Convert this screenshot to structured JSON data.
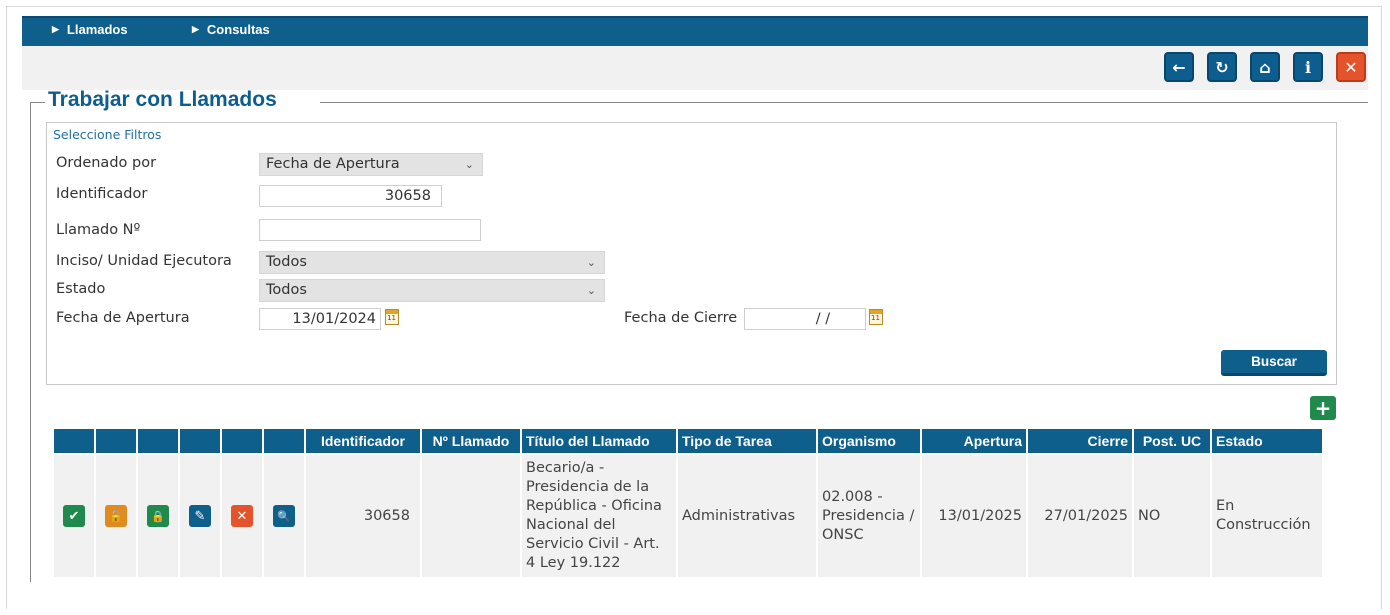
{
  "nav": {
    "items": [
      {
        "label": "Llamados"
      },
      {
        "label": "Consultas"
      }
    ]
  },
  "toolbar": {
    "buttons": [
      {
        "name": "back-icon",
        "glyph": "←"
      },
      {
        "name": "refresh-icon",
        "glyph": "↻"
      },
      {
        "name": "home-icon",
        "glyph": "⌂"
      },
      {
        "name": "info-icon",
        "glyph": "i"
      },
      {
        "name": "close-icon",
        "glyph": "✕"
      }
    ]
  },
  "page": {
    "title": "Trabajar con Llamados"
  },
  "filters": {
    "legend": "Seleccione Filtros",
    "ordenado_por": {
      "label": "Ordenado por",
      "value": "Fecha de Apertura"
    },
    "identificador": {
      "label": "Identificador",
      "value": "30658"
    },
    "llamado_no": {
      "label": "Llamado Nº",
      "value": ""
    },
    "inciso": {
      "label": "Inciso/ Unidad Ejecutora",
      "value": "Todos"
    },
    "estado": {
      "label": "Estado",
      "value": "Todos"
    },
    "fecha_apertura": {
      "label": "Fecha de Apertura",
      "value": "13/01/2024"
    },
    "fecha_cierre": {
      "label": "Fecha de Cierre",
      "value": "/ /"
    },
    "search_label": "Buscar",
    "calendar_day": "11"
  },
  "add_button": {
    "glyph": "+"
  },
  "grid": {
    "columns": [
      "",
      "",
      "",
      "",
      "",
      "",
      "Identificador",
      "Nº Llamado",
      "Título del Llamado",
      "Tipo de Tarea",
      "Organismo",
      "Apertura",
      "Cierre",
      "Post. UC",
      "Estado"
    ],
    "actions": [
      {
        "name": "approve-icon",
        "glyph": "✔",
        "color": "#1f8a4c"
      },
      {
        "name": "lock-open-icon",
        "glyph": "🔓",
        "color": "#e08a1f"
      },
      {
        "name": "lock-icon",
        "glyph": "🔒",
        "color": "#1f8a4c"
      },
      {
        "name": "edit-icon",
        "glyph": "✎",
        "color": "#0f5f8d"
      },
      {
        "name": "delete-icon",
        "glyph": "✕",
        "color": "#e5532c"
      },
      {
        "name": "view-icon",
        "glyph": "🔍",
        "color": "#0f5f8d"
      }
    ],
    "rows": [
      {
        "identificador": "30658",
        "no_llamado": "",
        "titulo": "Becario/a - Presidencia de la República - Oficina Nacional del Servicio Civil - Art. 4 Ley 19.122",
        "tipo_tarea": "Administrativas",
        "organismo": "02.008 - Presidencia / ONSC",
        "apertura": "13/01/2025",
        "cierre": "27/01/2025",
        "post_uc": "NO",
        "estado": "En Construcción"
      }
    ]
  },
  "colors": {
    "primary": "#0f5f8d",
    "danger": "#e5532c",
    "success": "#1f8a4c",
    "warning": "#e08a1f"
  }
}
